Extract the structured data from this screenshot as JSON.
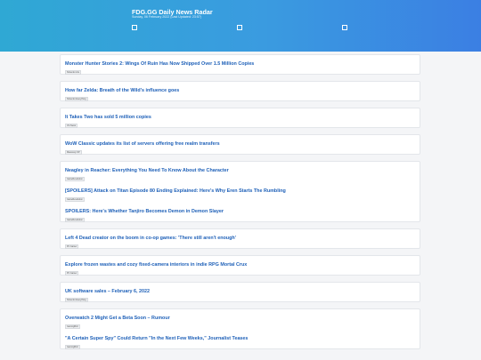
{
  "header": {
    "title": "FDG.GG Daily News Radar",
    "subtitle": "Sunday, 06 February 2022 (Last Updated: 23:57)"
  },
  "cards": [
    {
      "entries": [
        {
          "headline": "Monster Hunter Stories 2: Wings Of Ruin Has Now Shipped Over 1.5 Million Copies",
          "source": "Nintendo Life"
        }
      ]
    },
    {
      "entries": [
        {
          "headline": "How far Zelda: Breath of the Wild's influence goes",
          "source": "Nintendo Everything"
        }
      ]
    },
    {
      "entries": [
        {
          "headline": "It Takes Two has sold 5 million copies",
          "source": "VG News"
        }
      ]
    },
    {
      "entries": [
        {
          "headline": "WoW Classic updates its list of servers offering free realm transfers",
          "source": "Massively OP"
        }
      ]
    },
    {
      "entries": [
        {
          "headline": "Neagley in Reacher: Everything You Need To Know About the Character",
          "source": "GameRevolution"
        },
        {
          "headline": "[SPOILERS] Attack on Titan Episode 80 Ending Explained: Here's Why Eren Starts The Rumbling",
          "source": "GameRevolution"
        },
        {
          "headline": "SPOILERS: Here's Whether Tanjiro Becomes Demon in Demon Slayer",
          "source": "GameRevolution"
        }
      ]
    },
    {
      "entries": [
        {
          "headline": "Left 4 Dead creator on the boom in co-op games: 'There still aren't enough'",
          "source": "PC Gamer"
        }
      ]
    },
    {
      "entries": [
        {
          "headline": "Explore frozen wastes and cozy fixed-camera interiors in indie RPG Mortal Crux",
          "source": "PC Gamer"
        }
      ]
    },
    {
      "entries": [
        {
          "headline": "UK software sales – February 6, 2022",
          "source": "Nintendo Everything"
        }
      ]
    },
    {
      "entries": [
        {
          "headline": "Overwatch 2 Might Get a Beta Soon – Rumour",
          "source": "GamingBolt"
        },
        {
          "headline": "\"A Certain Super Spy\" Could Return \"In the Next Few Weeks,\" Journalist Teases",
          "source": "GamingBolt"
        }
      ]
    }
  ]
}
